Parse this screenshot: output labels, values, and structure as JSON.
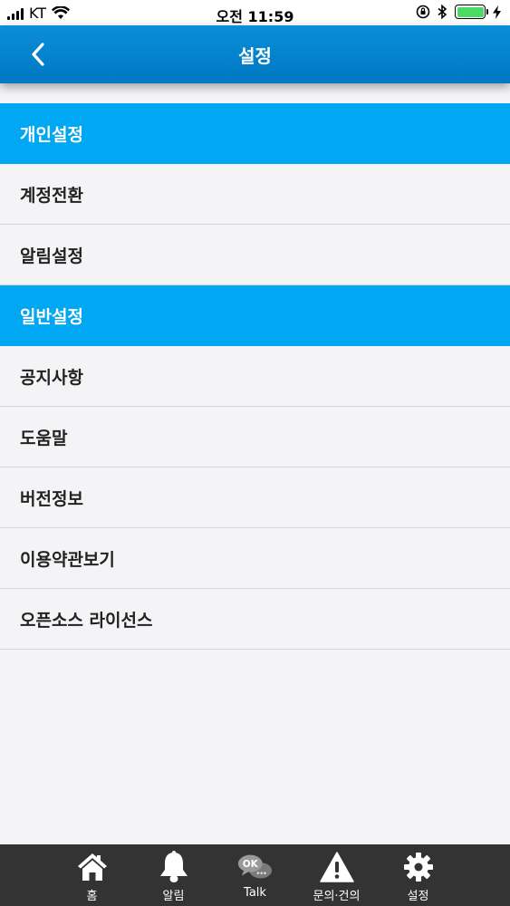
{
  "status_bar": {
    "carrier": "KT",
    "time": "오전 11:59"
  },
  "header": {
    "title": "설정"
  },
  "sections": [
    {
      "title": "개인설정",
      "items": [
        "계정전환",
        "알림설정"
      ]
    },
    {
      "title": "일반설정",
      "items": [
        "공지사항",
        "도움말",
        "버전정보",
        "이용약관보기",
        "오픈소스 라이선스"
      ]
    }
  ],
  "tab_bar": {
    "items": [
      {
        "label": "홈",
        "icon": "home-icon"
      },
      {
        "label": "알림",
        "icon": "bell-icon"
      },
      {
        "label": "Talk",
        "icon": "talk-bubble-icon",
        "icon_text": "OK"
      },
      {
        "label": "문의·건의",
        "icon": "warning-icon"
      },
      {
        "label": "설정",
        "icon": "gear-icon"
      }
    ]
  },
  "colors": {
    "header": "#0a8fd6",
    "section": "#00a7f2",
    "tab_bar": "#333333",
    "battery": "#4cd964"
  }
}
